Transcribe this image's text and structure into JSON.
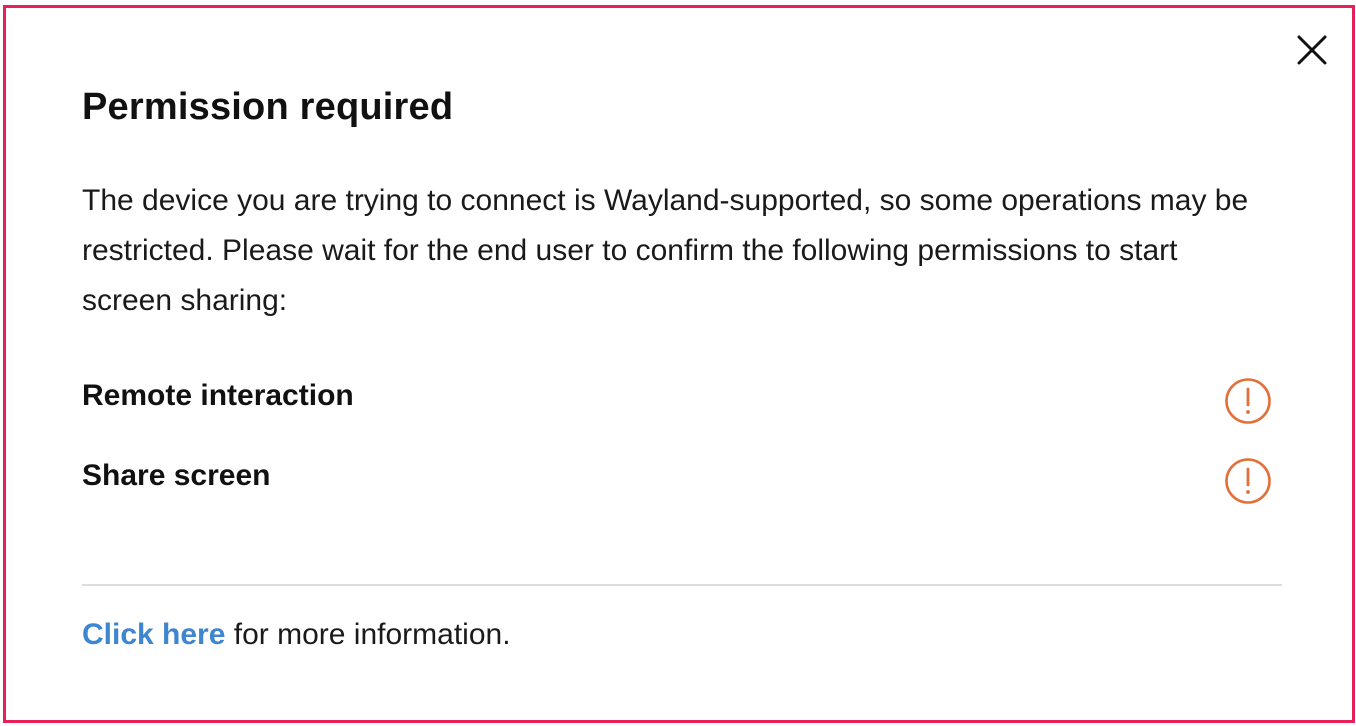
{
  "dialog": {
    "title": "Permission required",
    "description": "The device you are trying to connect is Wayland-supported, so some operations may be restricted. Please wait for the end user to confirm the following permissions to start screen sharing:",
    "close_icon": "close-icon",
    "border_color": "#e8205a"
  },
  "permissions": [
    {
      "label": "Remote interaction",
      "status_icon": "warning-circle-icon",
      "status_color": "#e2703a"
    },
    {
      "label": "Share screen",
      "status_icon": "warning-circle-icon",
      "status_color": "#e2703a"
    }
  ],
  "footer": {
    "link_text": "Click here",
    "text": " for more information.",
    "link_color": "#3f86d0"
  }
}
